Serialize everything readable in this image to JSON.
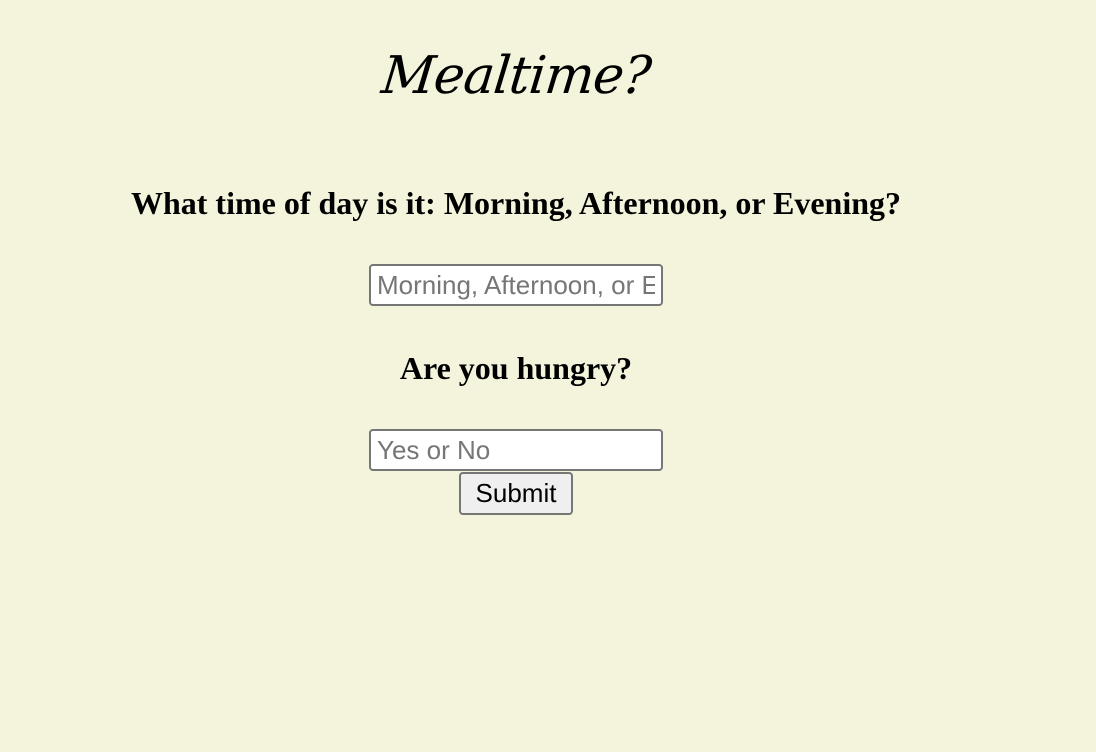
{
  "page": {
    "title": "Mealtime?"
  },
  "form": {
    "time_question": "What time of day is it: Morning, Afternoon, or Evening?",
    "time_input": {
      "value": "",
      "placeholder": "Morning, Afternoon, or Evening"
    },
    "hunger_question": "Are you hungry?",
    "hunger_input": {
      "value": "",
      "placeholder": "Yes or No"
    },
    "submit_label": "Submit"
  },
  "colors": {
    "background": "#f4f4dc",
    "text": "#000000",
    "input_border": "#767676",
    "button_background": "#efefef"
  }
}
